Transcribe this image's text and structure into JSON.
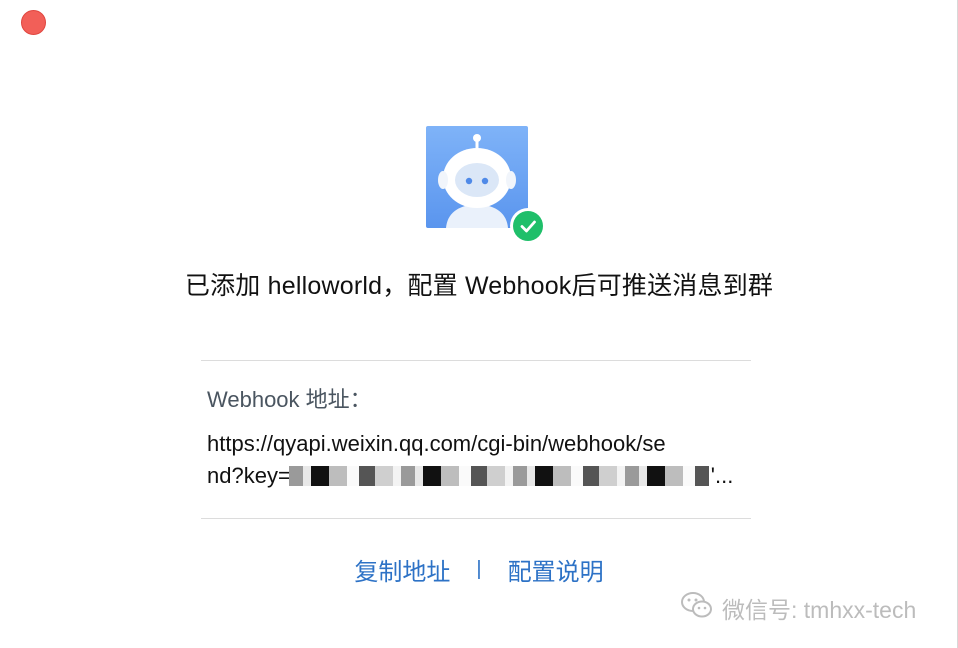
{
  "window": {
    "close_button": "close"
  },
  "bot": {
    "avatar_icon": "robot-avatar-icon",
    "badge_icon": "checkmark-icon",
    "badge_color": "#1fbf6a"
  },
  "headline": "已添加 helloworld，配置 Webhook后可推送消息到群",
  "webhook": {
    "label": "Webhook 地址：",
    "url_line1": "https://qyapi.weixin.qq.com/cgi-bin/webhook/se",
    "url_line2_prefix": "nd?key=",
    "url_line2_suffix": "'..."
  },
  "actions": {
    "copy_label": "复制地址",
    "separator": "|",
    "config_label": "配置说明",
    "link_color": "#2d72c6"
  },
  "watermark": {
    "text": "微信号: tmhxx-tech"
  }
}
